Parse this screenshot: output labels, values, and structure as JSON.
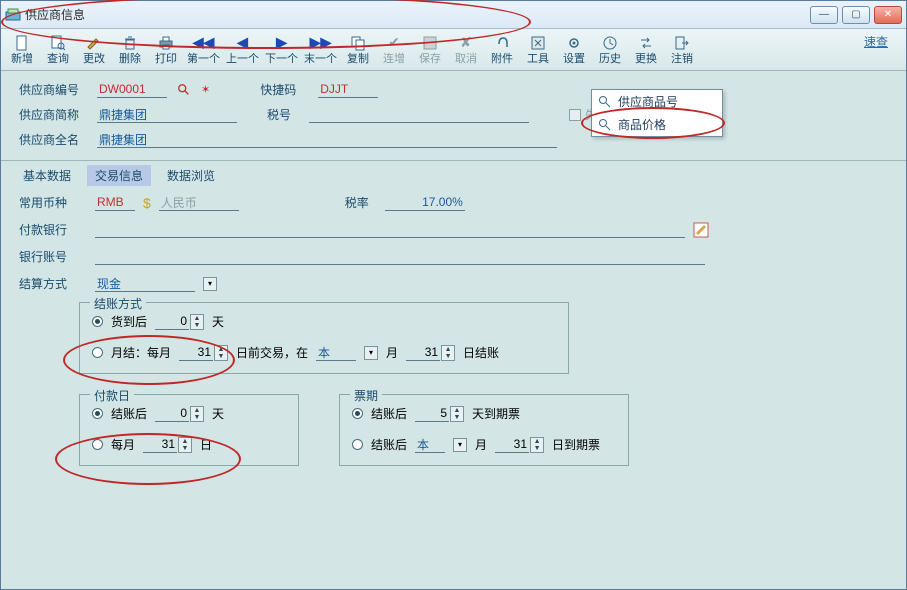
{
  "window": {
    "title": "供应商信息"
  },
  "toolbar": {
    "items": [
      {
        "key": "new",
        "label": "新增",
        "icon": "doc"
      },
      {
        "key": "query",
        "label": "查询",
        "icon": "docq"
      },
      {
        "key": "edit",
        "label": "更改",
        "icon": "pencil"
      },
      {
        "key": "delete",
        "label": "删除",
        "icon": "trash"
      },
      {
        "key": "print",
        "label": "打印",
        "icon": "printer"
      },
      {
        "key": "first",
        "label": "第一个",
        "icon": "first"
      },
      {
        "key": "prev",
        "label": "上一个",
        "icon": "prev"
      },
      {
        "key": "next",
        "label": "下一个",
        "icon": "next"
      },
      {
        "key": "last",
        "label": "末一个",
        "icon": "last"
      },
      {
        "key": "copy",
        "label": "复制",
        "icon": "copy"
      },
      {
        "key": "cont",
        "label": "连增",
        "icon": "check",
        "disabled": true
      },
      {
        "key": "save",
        "label": "保存",
        "icon": "save",
        "disabled": true
      },
      {
        "key": "cancel",
        "label": "取消",
        "icon": "x",
        "disabled": true
      },
      {
        "key": "attach",
        "label": "附件",
        "icon": "clip"
      },
      {
        "key": "tools",
        "label": "工具",
        "icon": "tools"
      },
      {
        "key": "settings",
        "label": "设置",
        "icon": "gear"
      },
      {
        "key": "history",
        "label": "历史",
        "icon": "hist"
      },
      {
        "key": "swap",
        "label": "更换",
        "icon": "swap"
      },
      {
        "key": "logout",
        "label": "注销",
        "icon": "logout"
      }
    ],
    "quick_search": "速查"
  },
  "header_form": {
    "supplier_no_label": "供应商编号",
    "supplier_no_value": "DW0001",
    "quick_code_label": "快捷码",
    "quick_code_value": "DJJT",
    "supplier_short_label": "供应商简称",
    "supplier_short_value": "鼎捷集团",
    "tax_no_label": "税号",
    "tax_no_value": "",
    "supplier_full_label": "供应商全名",
    "supplier_full_value": "鼎捷集团",
    "invalid_label": "失效"
  },
  "dropdown": {
    "items": [
      "供应商品号",
      "商品价格"
    ]
  },
  "tabs": {
    "items": [
      "基本数据",
      "交易信息",
      "数据浏览"
    ],
    "active": 1
  },
  "trade": {
    "currency_label": "常用币种",
    "currency_code": "RMB",
    "currency_name": "人民币",
    "tax_rate_label": "税率",
    "tax_rate_value": "17.00%",
    "pay_bank_label": "付款银行",
    "pay_bank_value": "",
    "bank_acct_label": "银行账号",
    "bank_acct_value": "",
    "settle_method_label": "结算方式",
    "settle_method_value": "现金",
    "billing_method": {
      "legend": "结账方式",
      "opt1_label": "货到后",
      "opt1_days": "0",
      "days_suffix": "天",
      "opt2_prefix": "月结：每月",
      "opt2_day": "31",
      "opt2_mid1": "日前交易，在",
      "opt2_month_val": "本",
      "opt2_mid2": "月",
      "opt2_billday": "31",
      "opt2_suffix": "日结账"
    },
    "pay_date": {
      "legend": "付款日",
      "opt1_label": "结账后",
      "opt1_days": "0",
      "days_suffix": "天",
      "opt2_label": "每月",
      "opt2_day": "31",
      "opt2_suffix": "日"
    },
    "draft_period": {
      "legend": "票期",
      "opt1_label": "结账后",
      "opt1_days": "5",
      "opt1_suffix": "天到期票",
      "opt2_label": "结账后",
      "opt2_month_val": "本",
      "opt2_mid": "月",
      "opt2_day": "31",
      "opt2_suffix": "日到期票"
    }
  }
}
